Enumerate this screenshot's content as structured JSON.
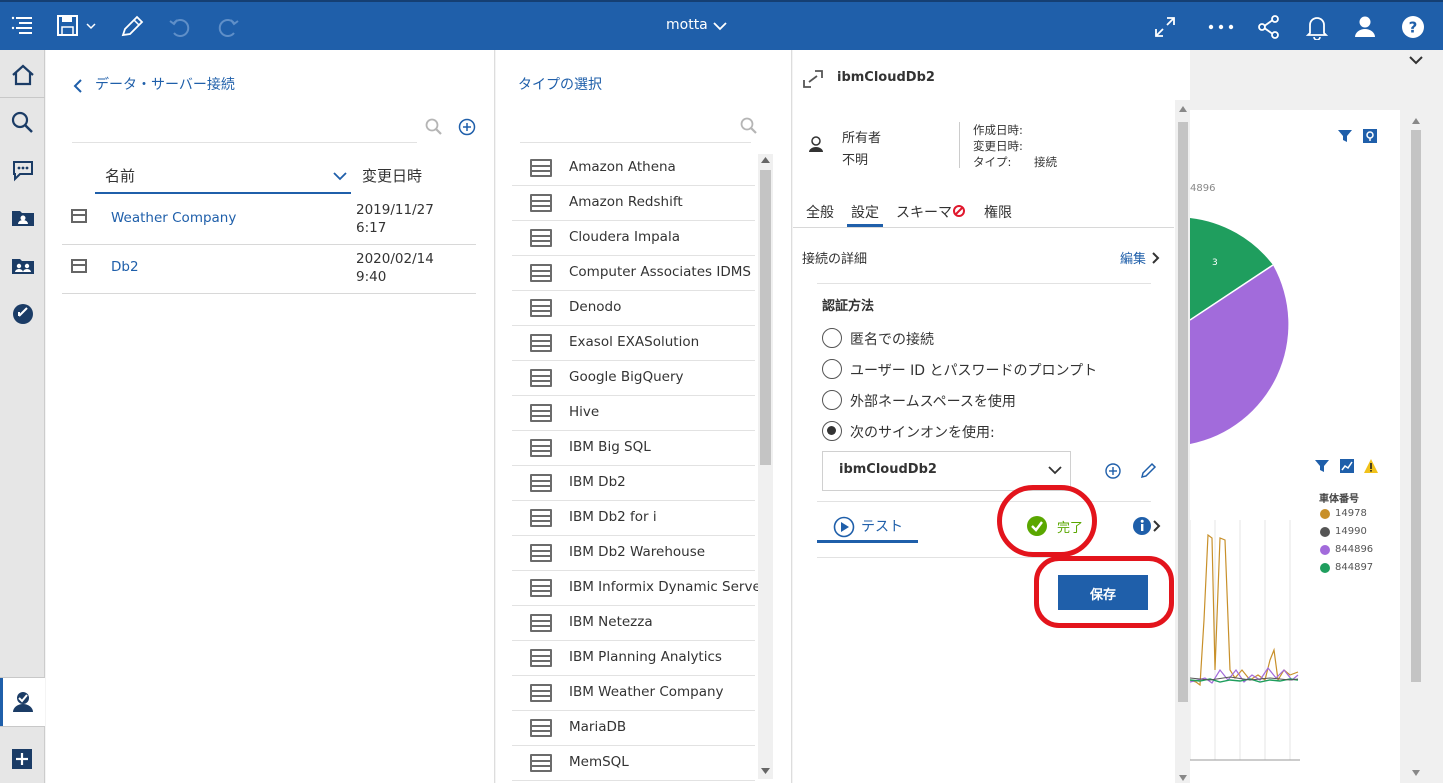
{
  "topbar": {
    "title": "motta"
  },
  "panel1": {
    "back_label": "データ・サーバー接続",
    "col_name": "名前",
    "col_modified": "変更日時",
    "rows": [
      {
        "name": "Weather Company",
        "date": "2019/11/27",
        "time": "6:17"
      },
      {
        "name": "Db2",
        "date": "2020/02/14",
        "time": "9:40"
      }
    ]
  },
  "panel2": {
    "title": "タイプの選択",
    "types": [
      "Amazon Athena",
      "Amazon Redshift",
      "Cloudera Impala",
      "Computer Associates IDMS",
      "Denodo",
      "Exasol EXASolution",
      "Google BigQuery",
      "Hive",
      "IBM Big SQL",
      "IBM Db2",
      "IBM Db2 for i",
      "IBM Db2 Warehouse",
      "IBM Informix Dynamic Server",
      "IBM Netezza",
      "IBM Planning Analytics",
      "IBM Weather Company",
      "MariaDB",
      "MemSQL"
    ]
  },
  "panel3": {
    "title": "ibmCloudDb2",
    "owner_label": "所有者",
    "owner_value": "不明",
    "created_label": "作成日時:",
    "modified_label": "変更日時:",
    "type_label": "タイプ:",
    "type_value": "接続",
    "tabs": [
      "全般",
      "設定",
      "スキーマ",
      "権限"
    ],
    "details_label": "接続の詳細",
    "edit_label": "編集",
    "auth_title": "認証方法",
    "auth_options": [
      "匿名での接続",
      "ユーザー ID とパスワードのプロンプト",
      "外部ネームスペースを使用",
      "次のサインオンを使用:"
    ],
    "signon_value": "ibmCloudDb2",
    "test_label": "テスト",
    "status_label": "完了",
    "save_label": "保存"
  },
  "background": {
    "pie_partial_label": "4896",
    "pie_slice_label": "3",
    "legend_title": "車体番号",
    "legend": [
      {
        "label": "14978",
        "color": "#c8902a"
      },
      {
        "label": "14990",
        "color": "#555555"
      },
      {
        "label": "844896",
        "color": "#a26bdb"
      },
      {
        "label": "844897",
        "color": "#1f9e5e"
      }
    ]
  }
}
